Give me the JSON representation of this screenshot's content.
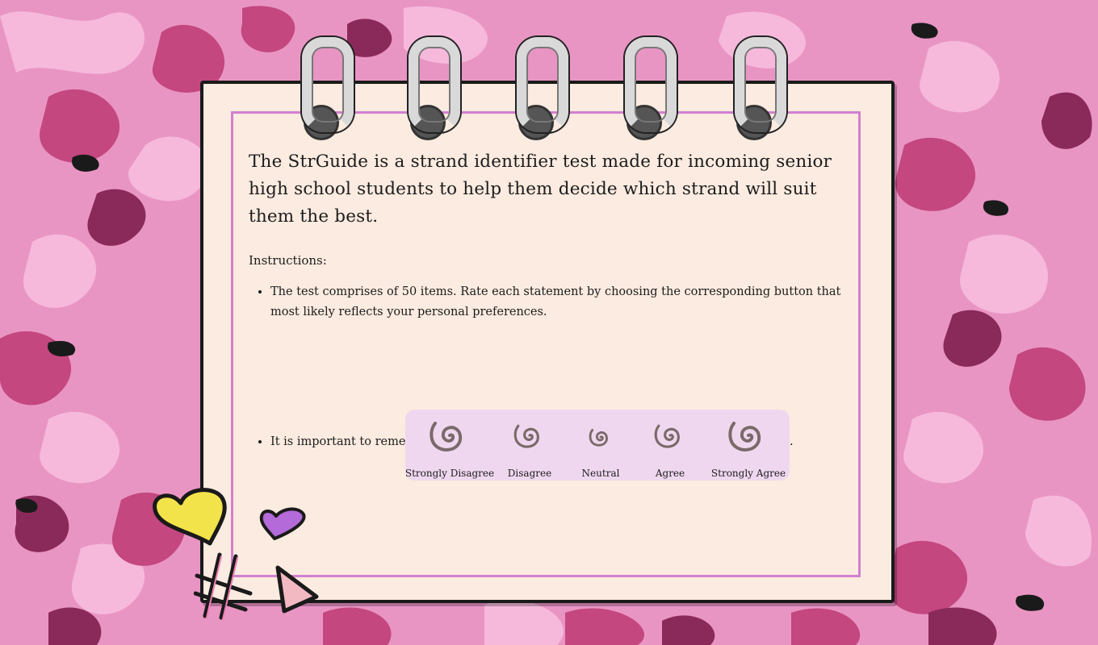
{
  "intro": "The StrGuide is a strand identifier test made for incoming senior high school students to help them decide which strand will suit them the best.",
  "instructions_title": "Instructions:",
  "instructions": [
    "The test comprises of 50 items. Rate each statement by choosing the corresponding button that most likely reflects your personal preferences.",
    "It is important to remember that there is no \"right\" or \"wrong\" answer to the questions."
  ],
  "scale": [
    {
      "label": "Strongly Disagree",
      "icon": "swirl-icon"
    },
    {
      "label": "Disagree",
      "icon": "swirl-icon"
    },
    {
      "label": "Neutral",
      "icon": "swirl-icon"
    },
    {
      "label": "Agree",
      "icon": "swirl-icon"
    },
    {
      "label": "Strongly Agree",
      "icon": "swirl-icon"
    }
  ],
  "colors": {
    "background": "#e88fc0",
    "paper": "#fbebe0",
    "frame": "#d47fcf",
    "scale_panel": "#efd8ef",
    "swirl": "#7a6a6a"
  }
}
